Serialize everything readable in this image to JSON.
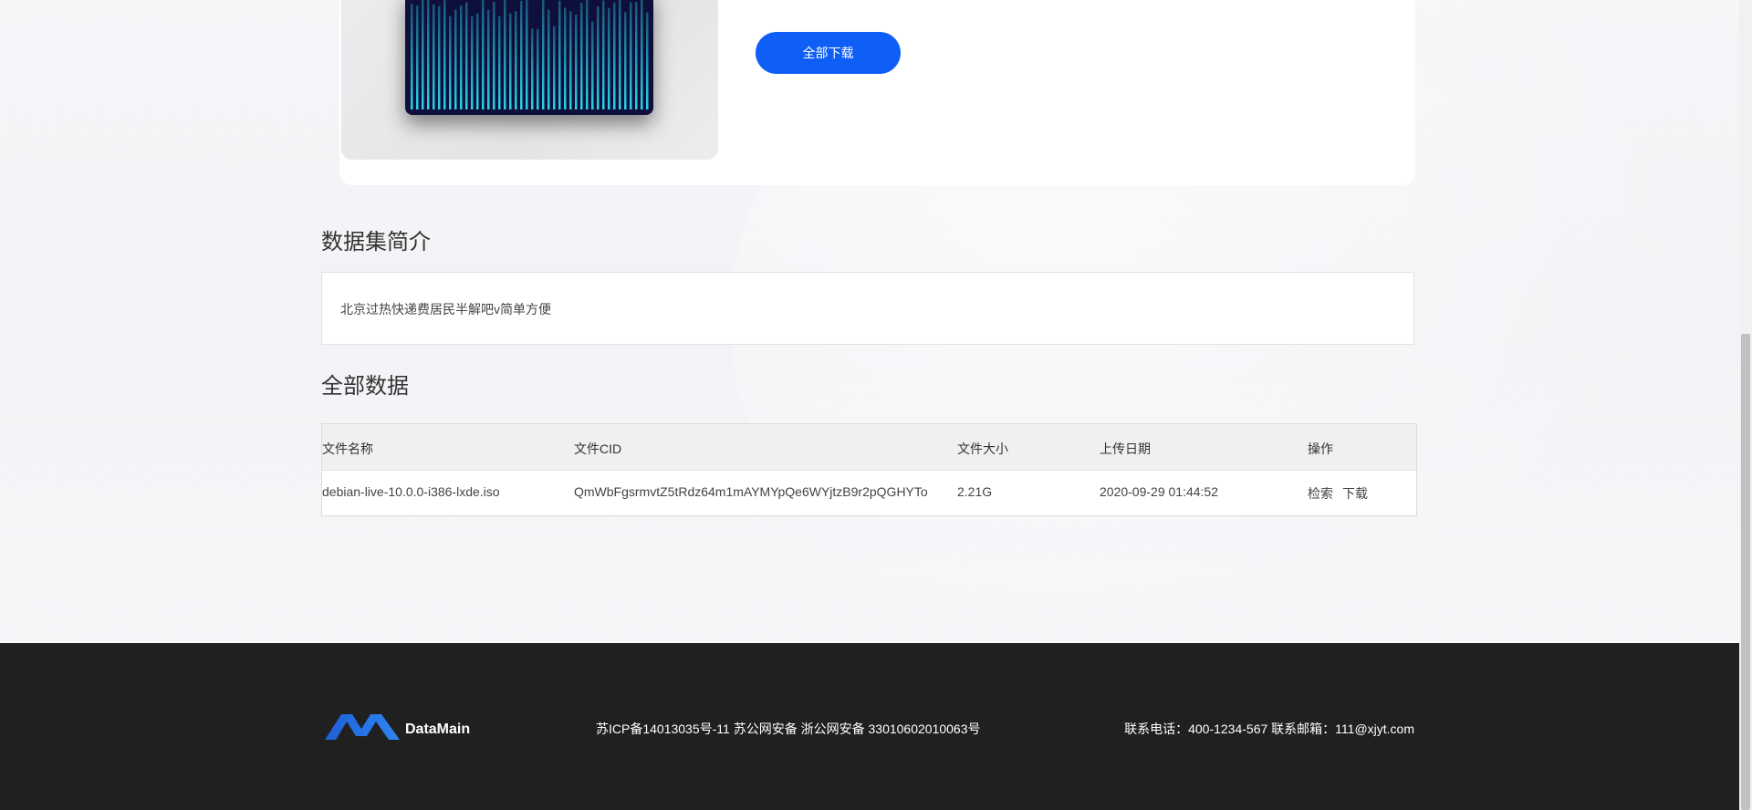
{
  "actions": {
    "download_all": "全部下载"
  },
  "intro": {
    "title": "数据集简介",
    "text": "北京过热快递费居民半解吧v简单方便"
  },
  "data_section": {
    "title": "全部数据",
    "columns": [
      "文件名称",
      "文件CID",
      "文件大小",
      "上传日期",
      "操作"
    ],
    "rows": [
      {
        "name": "debian-live-10.0.0-i386-lxde.iso",
        "cid": "QmWbFgsrmvtZ5tRdz64m1mAYMYpQe6WYjtzB9r2pQGHYTo",
        "size": "2.21G",
        "date": "2020-09-29 01:44:52",
        "action_search": "检索",
        "action_download": "下载"
      }
    ]
  },
  "footer": {
    "brand": "DataMain",
    "icp": "苏ICP备14013035号-11 苏公网安备 浙公网安备 33010602010063号",
    "contact": "联系电话：400-1234-567 联系邮箱：111@xjyt.com"
  },
  "colors": {
    "accent": "#0f5ef6",
    "link": "#1e74e8",
    "footer_bg": "#202020",
    "thumb_bg": "#0e0f3a",
    "thumb_bars": "#2ad4e8"
  },
  "icons": {
    "logo": "datamain-logo-icon"
  }
}
